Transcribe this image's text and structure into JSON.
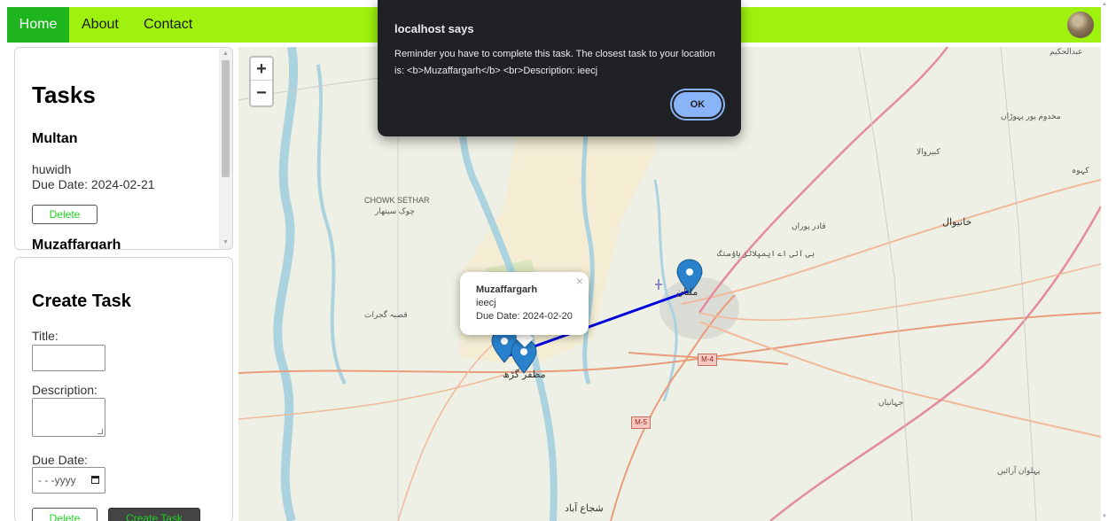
{
  "nav": {
    "home": "Home",
    "about": "About",
    "contact": "Contact"
  },
  "tasks": {
    "title": "Tasks",
    "items": [
      {
        "name": "Multan",
        "description": "huwidh",
        "due": "Due Date: 2024-02-21",
        "delete_label": "Delete"
      },
      {
        "name": "Muzaffargarh"
      }
    ]
  },
  "create": {
    "title": "Create Task",
    "title_label": "Title:",
    "title_value": "",
    "description_label": "Description:",
    "description_value": "",
    "due_label": "Due Date:",
    "due_placeholder": "- - -yyyy",
    "delete_label": "Delete",
    "create_label": "Create Task"
  },
  "map": {
    "zoom_in": "+",
    "zoom_out": "−",
    "labels": {
      "chowk_sethar_en": "CHOWK SETHAR",
      "chowk_sethar_ur": "چوک سیتھار",
      "qasba_gujrat": "قصبہ گجرات",
      "muzaffargarh_ur": "مظفر گڑھ",
      "multan_ur": "ملتان",
      "qadir_pur": "قادر پوراں",
      "khanewal": "خانیوال",
      "kabirwala": "کبیروالا",
      "makhdoom": "مخدوم پور پہوڑاں",
      "jahanian": "جہانیاں",
      "pahlwan": "پہلوان آرائیں",
      "shujaabad": "شجاع آباد",
      "bosan": "بی آئی اے ایمپلائز ہاؤسنگ",
      "abdulhakim": "عبدالحکیم",
      "kohna": "کہوہ"
    },
    "shields": {
      "m4": "M-4",
      "m5": "M-5"
    },
    "popup": {
      "title": "Muzaffargarh",
      "description": "ieecj",
      "due": "Due Date: 2024-02-20",
      "close": "×"
    },
    "route_color": "#0000dd",
    "marker_color": "#2a81cb"
  },
  "dialog": {
    "title": "localhost says",
    "message": "Reminder you have to complete this task. The closest task to your location is: <b>Muzaffargarh</b> <br>Description: ieecj",
    "ok_label": "OK"
  },
  "colors": {
    "nav_bg": "#9ff20f",
    "nav_active": "#1fb51f",
    "dialog_bg": "#202124",
    "ok_bg": "#8ab4f8",
    "accent_green": "#1fd41f"
  }
}
